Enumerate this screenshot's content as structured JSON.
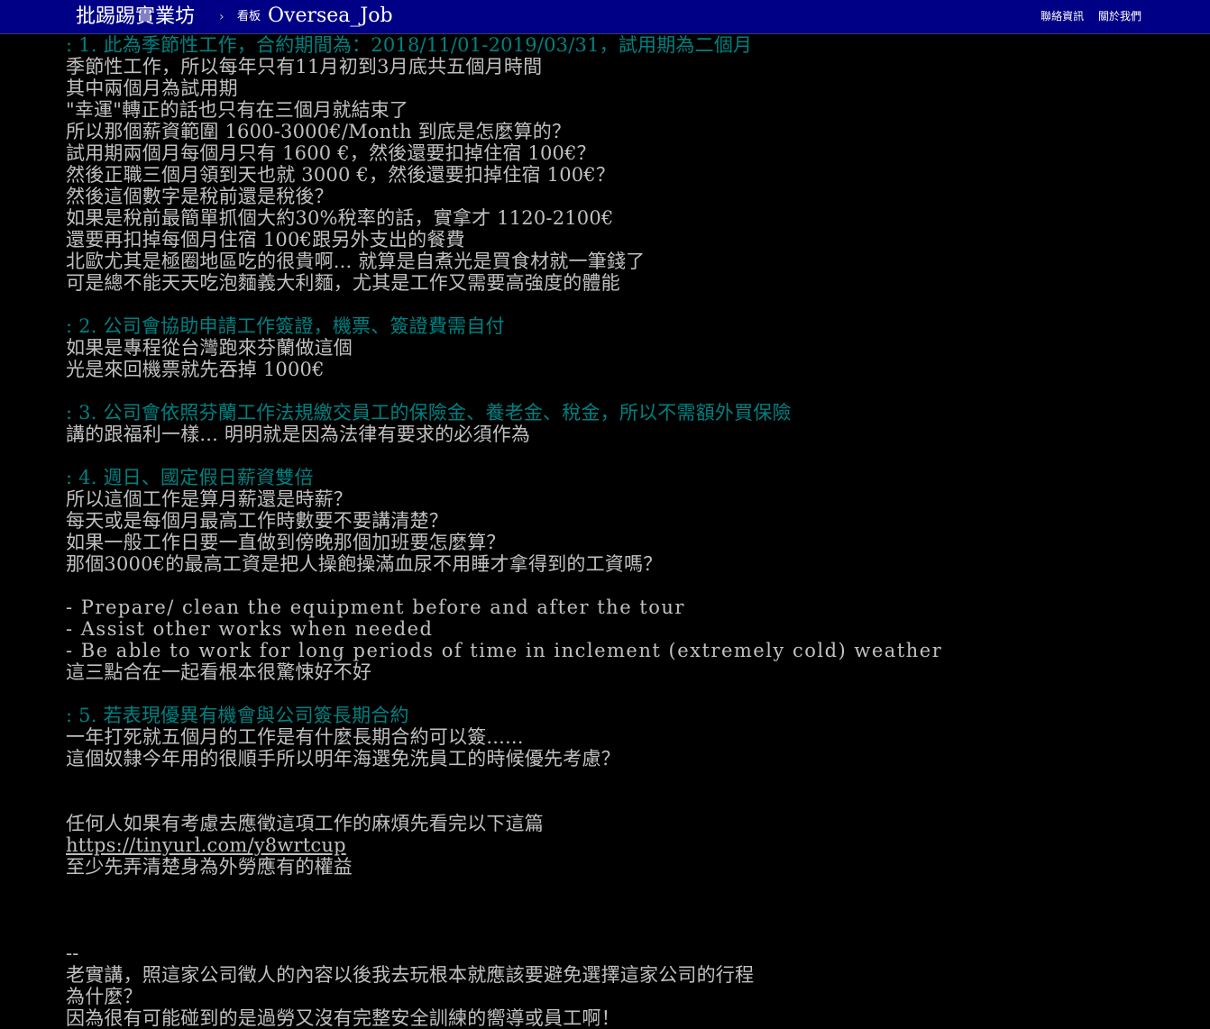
{
  "header": {
    "site_name": "批踢踢實業坊",
    "separator": "›",
    "board_label": "看板",
    "board_name": "Oversea_Job",
    "links": [
      "聯絡資訊",
      "關於我們"
    ]
  },
  "colors": {
    "header_bg": "#000086",
    "body_bg": "#000000",
    "text": "#c0c0c0",
    "quote": "#008080"
  },
  "lines": [
    {
      "type": "quote",
      "text": ": 1. 此為季節性工作，合約期間為：2018/11/01-2019/03/31，試用期為二個月"
    },
    {
      "type": "text",
      "text": "季節性工作，所以每年只有11月初到3月底共五個月時間"
    },
    {
      "type": "text",
      "text": "其中兩個月為試用期"
    },
    {
      "type": "text",
      "text": "\"幸運\"轉正的話也只有在三個月就結束了"
    },
    {
      "type": "text",
      "text": "所以那個薪資範圍 1600-3000€/Month 到底是怎麼算的？"
    },
    {
      "type": "text",
      "text": "試用期兩個月每個月只有 1600 €，然後還要扣掉住宿 100€？"
    },
    {
      "type": "text",
      "text": "然後正職三個月領到天也就 3000 €，然後還要扣掉住宿 100€？"
    },
    {
      "type": "text",
      "text": "然後這個數字是稅前還是稅後？"
    },
    {
      "type": "text",
      "text": "如果是稅前最簡單抓個大約30%稅率的話，實拿才 1120-2100€"
    },
    {
      "type": "text",
      "text": "還要再扣掉每個月住宿 100€跟另外支出的餐費"
    },
    {
      "type": "text",
      "text": "北歐尤其是極圈地區吃的很貴啊... 就算是自煮光是買食材就一筆錢了"
    },
    {
      "type": "text",
      "text": "可是總不能天天吃泡麵義大利麵，尤其是工作又需要高強度的體能"
    },
    {
      "type": "blank",
      "text": ""
    },
    {
      "type": "quote",
      "text": ": 2. 公司會協助申請工作簽證，機票、簽證費需自付"
    },
    {
      "type": "text",
      "text": "如果是專程從台灣跑來芬蘭做這個"
    },
    {
      "type": "text",
      "text": "光是來回機票就先吞掉 1000€"
    },
    {
      "type": "blank",
      "text": ""
    },
    {
      "type": "quote",
      "text": ": 3. 公司會依照芬蘭工作法規繳交員工的保險金、養老金、稅金，所以不需額外買保險"
    },
    {
      "type": "text",
      "text": "講的跟福利一樣... 明明就是因為法律有要求的必須作為"
    },
    {
      "type": "blank",
      "text": ""
    },
    {
      "type": "quote",
      "text": ": 4. 週日、國定假日薪資雙倍"
    },
    {
      "type": "text",
      "text": "所以這個工作是算月薪還是時薪？"
    },
    {
      "type": "text",
      "text": "每天或是每個月最高工作時數要不要講清楚？"
    },
    {
      "type": "text",
      "text": "如果一般工作日要一直做到傍晚那個加班要怎麼算？"
    },
    {
      "type": "text",
      "text": "那個3000€的最高工資是把人操飽操滿血尿不用睡才拿得到的工資嗎？"
    },
    {
      "type": "blank",
      "text": ""
    },
    {
      "type": "eng",
      "text": "- Prepare/ clean the equipment before and after the tour"
    },
    {
      "type": "eng",
      "text": "- Assist other works when needed"
    },
    {
      "type": "eng",
      "text": "- Be able to work for long periods of time in inclement (extremely cold) weather"
    },
    {
      "type": "text",
      "text": "這三點合在一起看根本很驚悚好不好"
    },
    {
      "type": "blank",
      "text": ""
    },
    {
      "type": "quote",
      "text": ": 5. 若表現優異有機會與公司簽長期合約"
    },
    {
      "type": "text",
      "text": "一年打死就五個月的工作是有什麼長期合約可以簽......"
    },
    {
      "type": "text",
      "text": "這個奴隸今年用的很順手所以明年海選免洗員工的時候優先考慮？"
    },
    {
      "type": "blank",
      "text": ""
    },
    {
      "type": "blank",
      "text": ""
    },
    {
      "type": "text",
      "text": "任何人如果有考慮去應徵這項工作的麻煩先看完以下這篇"
    },
    {
      "type": "link",
      "text": "https://tinyurl.com/y8wrtcup"
    },
    {
      "type": "text",
      "text": "至少先弄清楚身為外勞應有的權益"
    },
    {
      "type": "blank",
      "text": ""
    },
    {
      "type": "blank",
      "text": ""
    },
    {
      "type": "blank",
      "text": ""
    },
    {
      "type": "text",
      "text": "--"
    },
    {
      "type": "text",
      "text": "老實講，照這家公司徵人的內容以後我去玩根本就應該要避免選擇這家公司的行程"
    },
    {
      "type": "text",
      "text": "為什麼？"
    },
    {
      "type": "text",
      "text": "因為很有可能碰到的是過勞又沒有完整安全訓練的嚮導或員工啊！"
    }
  ]
}
